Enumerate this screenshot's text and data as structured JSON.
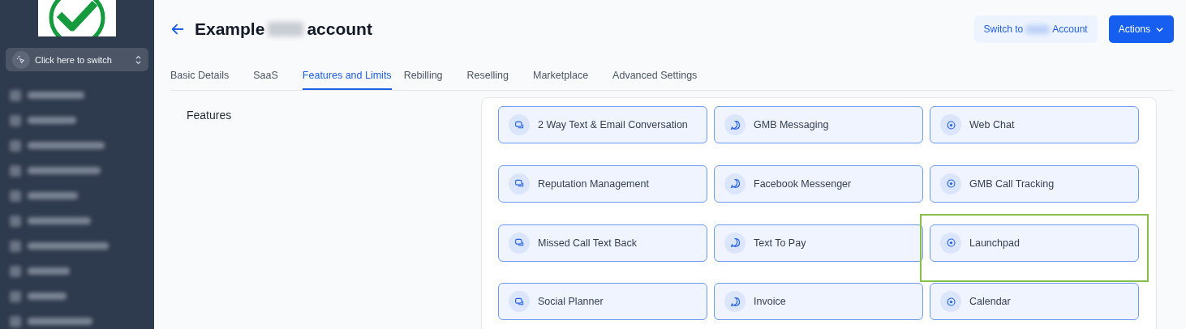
{
  "sidebar": {
    "switcher": {
      "label": "Click here to switch"
    }
  },
  "header": {
    "title_start": "Example",
    "title_end": "account",
    "switch_button": {
      "start": "Switch to",
      "end": "Account"
    },
    "actions_button": "Actions"
  },
  "tabs": [
    {
      "label": "Basic Details",
      "selected": false
    },
    {
      "label": "SaaS",
      "selected": false
    },
    {
      "label": "Features and Limits",
      "selected": true
    },
    {
      "label": "Rebilling",
      "selected": false
    },
    {
      "label": "Reselling",
      "selected": false
    },
    {
      "label": "Marketplace",
      "selected": false
    },
    {
      "label": "Advanced Settings",
      "selected": false
    }
  ],
  "section_title": "Features",
  "features": [
    {
      "label": "2 Way Text & Email Conversation",
      "highlighted": false
    },
    {
      "label": "GMB Messaging",
      "highlighted": false
    },
    {
      "label": "Web Chat",
      "highlighted": false
    },
    {
      "label": "Reputation Management",
      "highlighted": false
    },
    {
      "label": "Facebook Messenger",
      "highlighted": false
    },
    {
      "label": "GMB Call Tracking",
      "highlighted": false
    },
    {
      "label": "Missed Call Text Back",
      "highlighted": false
    },
    {
      "label": "Text To Pay",
      "highlighted": false
    },
    {
      "label": "Launchpad",
      "highlighted": true
    },
    {
      "label": "Social Planner",
      "highlighted": false
    },
    {
      "label": "Invoice",
      "highlighted": false
    },
    {
      "label": "Calendar",
      "highlighted": false
    }
  ]
}
